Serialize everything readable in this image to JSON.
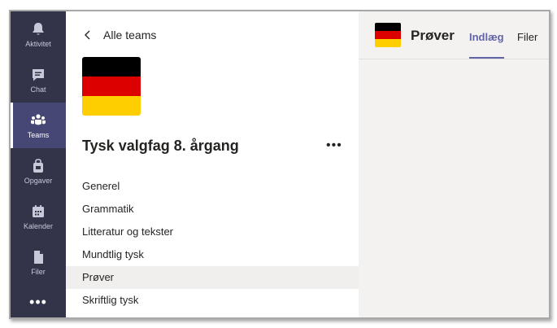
{
  "rail": {
    "items": [
      {
        "label": "Aktivitet",
        "icon": "bell-icon"
      },
      {
        "label": "Chat",
        "icon": "chat-icon"
      },
      {
        "label": "Teams",
        "icon": "teams-icon"
      },
      {
        "label": "Opgaver",
        "icon": "assignments-icon"
      },
      {
        "label": "Kalender",
        "icon": "calendar-icon"
      },
      {
        "label": "Filer",
        "icon": "files-icon"
      }
    ],
    "more": "•••"
  },
  "panel": {
    "back_label": "Alle teams",
    "team_name": "Tysk valgfag 8. årgang",
    "more_label": "•••",
    "channels": [
      "Generel",
      "Grammatik",
      "Litteratur og tekster",
      "Mundtlig tysk",
      "Prøver",
      "Skriftlig tysk"
    ],
    "selected_channel": "Prøver"
  },
  "channel_header": {
    "title": "Prøver",
    "tabs": [
      "Indlæg",
      "Filer"
    ],
    "active_tab": "Indlæg"
  },
  "colors": {
    "rail_bg": "#33344a",
    "rail_active": "#464775",
    "accent": "#6264a7",
    "flag_black": "#000000",
    "flag_red": "#dd0000",
    "flag_gold": "#ffce00"
  }
}
